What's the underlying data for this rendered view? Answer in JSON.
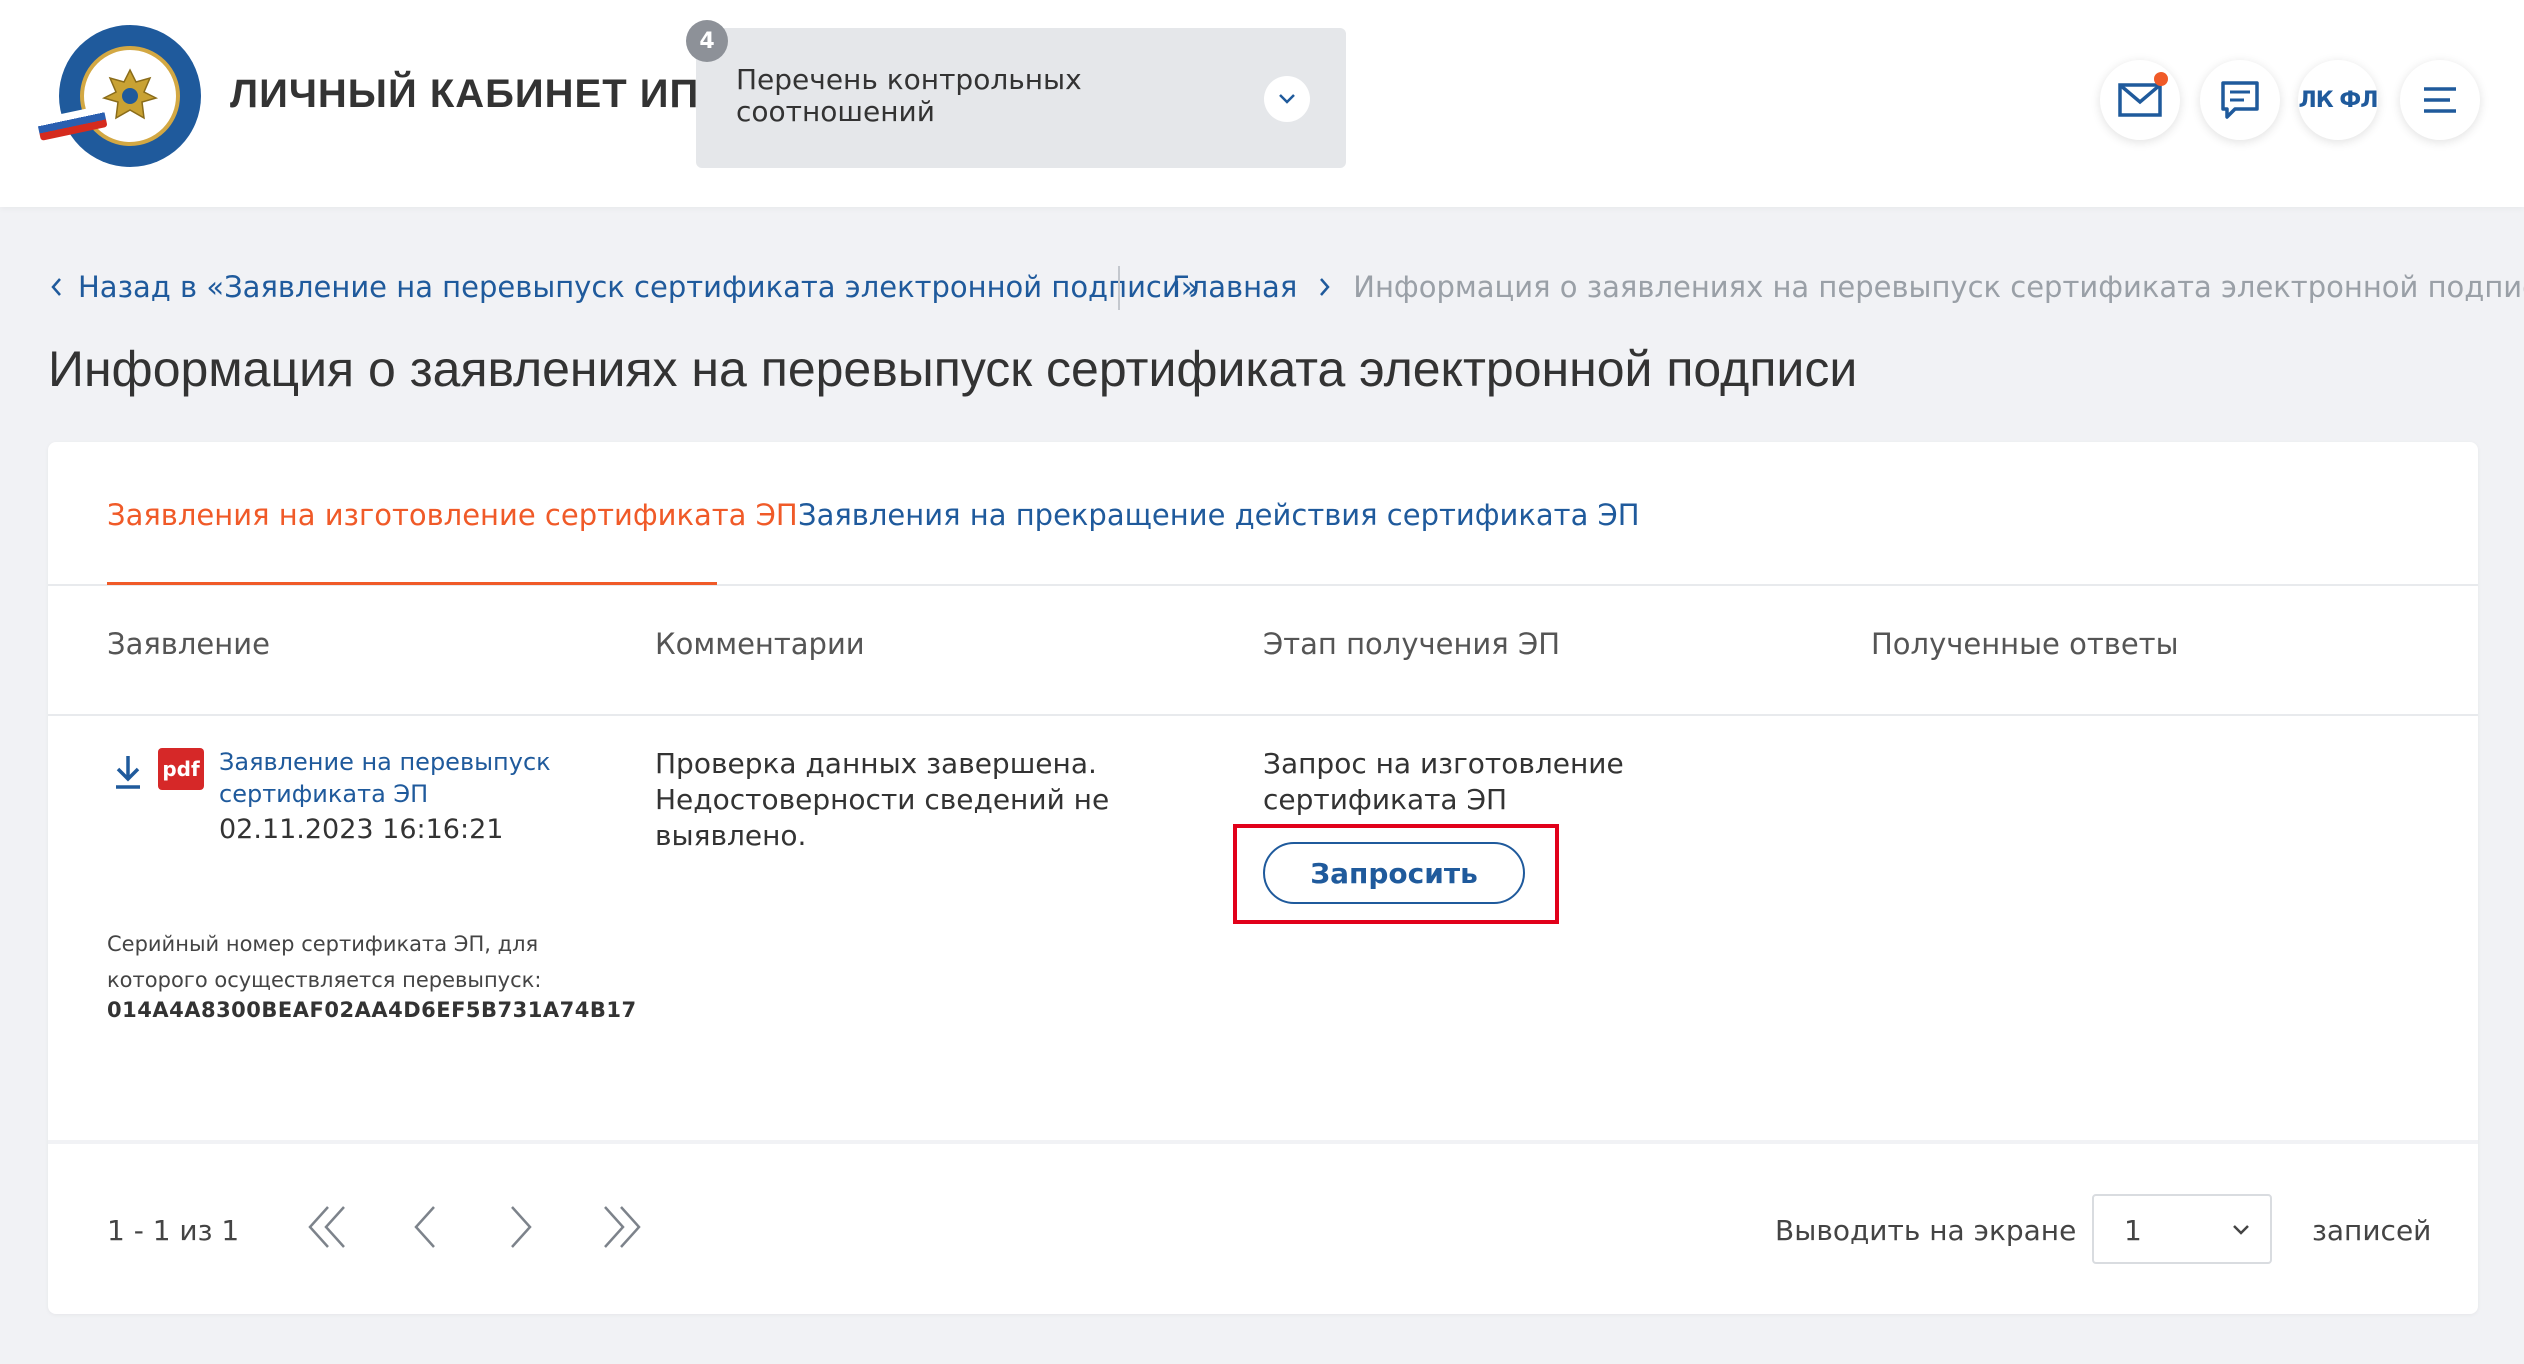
{
  "header": {
    "app_title": "ЛИЧНЫЙ КАБИНЕТ ИП",
    "control_select": {
      "badge": "4",
      "label": "Перечень контрольных соотношений"
    },
    "buttons": {
      "mail_icon": "mail-icon",
      "chat_icon": "chat-icon",
      "lk_fl": "ЛК ФЛ",
      "menu_icon": "menu-icon"
    },
    "colors": {
      "brand_blue": "#1f5a9c",
      "accent_orange": "#f05a28",
      "highlight_red": "#e1001a"
    }
  },
  "breadcrumbs": {
    "back_link": "Назад в «Заявление на перевыпуск сертификата электронной подписи»",
    "home": "Главная",
    "current": "Информация о заявлениях на перевыпуск сертификата электронной подписи"
  },
  "page_title": "Информация о заявлениях на перевыпуск сертификата электронной подписи",
  "tabs": [
    {
      "label": "Заявления на изготовление сертификата ЭП",
      "active": true
    },
    {
      "label": "Заявления на прекращение действия сертификата ЭП",
      "active": false
    }
  ],
  "table": {
    "columns": [
      "Заявление",
      "Комментарии",
      "Этап получения ЭП",
      "Полученные ответы"
    ],
    "rows": [
      {
        "pdf_badge": "pdf",
        "doc_link": "Заявление на перевыпуск сертификата ЭП",
        "date": "02.11.2023 16:16:21",
        "serial_label": "Серийный номер сертификата ЭП, для которого осуществляется перевыпуск:",
        "serial_value": "014A4A8300BEAF02AA4D6EF5B731A74B17",
        "comment": "Проверка данных завершена. Недостоверности сведений не выявлено.",
        "stage": "Запрос на изготовление сертификата ЭП",
        "stage_button": "Запросить",
        "answers": ""
      }
    ]
  },
  "pagination": {
    "count": "1 - 1 из 1",
    "per_page_label": "Выводить на экране",
    "per_page_value": "1",
    "records_label": "записей"
  }
}
